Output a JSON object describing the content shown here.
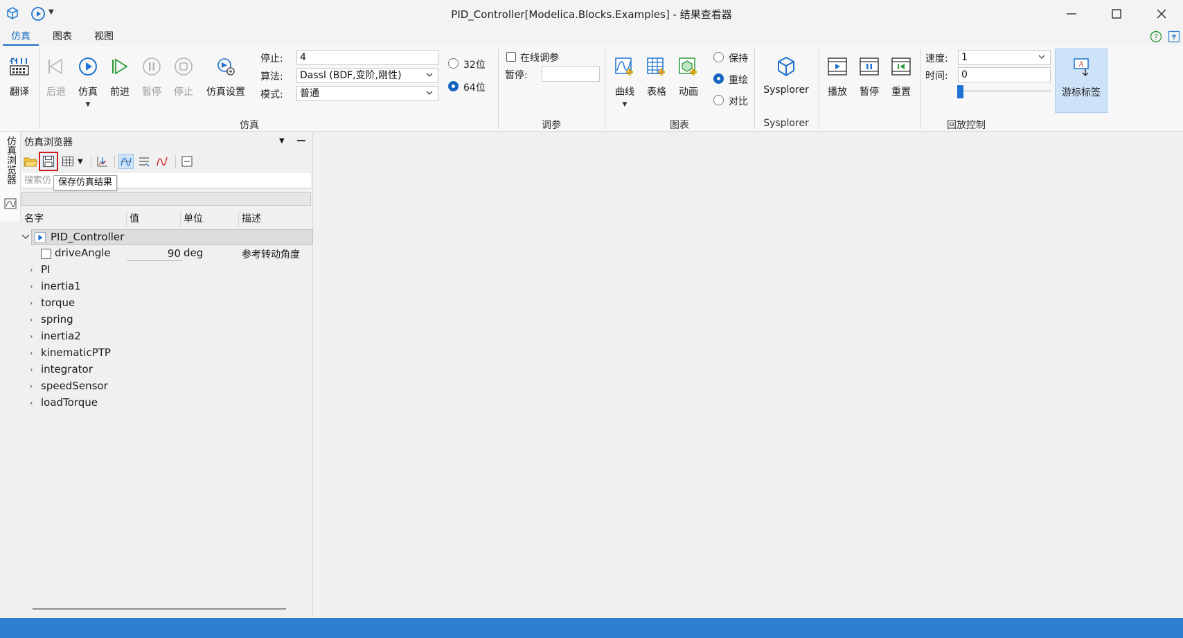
{
  "window": {
    "title": "PID_Controller[Modelica.Blocks.Examples] - 结果查看器"
  },
  "menu": {
    "tabs": [
      {
        "label": "仿真",
        "active": true
      },
      {
        "label": "图表",
        "active": false
      },
      {
        "label": "视图",
        "active": false
      }
    ]
  },
  "ribbon": {
    "translate_label": "翻译",
    "back_label": "后退",
    "simulate_label": "仿真",
    "forward_label": "前进",
    "pause_label": "暂停",
    "stop_label": "停止",
    "sim_settings_label": "仿真设置",
    "stop_time_label": "停止:",
    "stop_time_value": "4",
    "algorithm_label": "算法:",
    "algorithm_value": "Dassl (BDF,变阶,刚性)",
    "mode_label": "模式:",
    "mode_value": "普通",
    "bit32_label": "32位",
    "bit64_label": "64位",
    "simulation_group": "仿真",
    "online_tuning_label": "在线调参",
    "tuning_pause_label": "暂停:",
    "tuning_pause_value": "",
    "tuning_group": "调参",
    "curve_label": "曲线",
    "table_label": "表格",
    "animation_label": "动画",
    "keep_label": "保持",
    "redraw_label": "重绘",
    "compare_label": "对比",
    "chart_group": "图表",
    "sysplorer_label": "Sysplorer",
    "sysplorer_group": "Sysplorer",
    "play_label": "播放",
    "playback_pause_label": "暂停",
    "reset_label": "重置",
    "speed_label": "速度:",
    "speed_value": "1",
    "time_label": "时间:",
    "time_value": "0",
    "cursor_tag_label": "游标标签",
    "playback_group": "回放控制"
  },
  "sidetab": {
    "label": "仿真浏览器"
  },
  "browser": {
    "title": "仿真浏览器",
    "search_placeholder": "搜索仿",
    "tooltip": "保存仿真结果",
    "columns": [
      "名字",
      "值",
      "单位",
      "描述"
    ],
    "root": "PID_Controller",
    "param": {
      "name": "driveAngle",
      "value": "90",
      "unit": "deg",
      "description": "参考转动角度"
    },
    "children": [
      "PI",
      "inertia1",
      "torque",
      "spring",
      "inertia2",
      "kinematicPTP",
      "integrator",
      "speedSensor",
      "loadTorque"
    ]
  },
  "colors": {
    "accent": "#1a6fc4",
    "statusbar": "#2f7fd1",
    "highlight_border": "#d0181b"
  }
}
